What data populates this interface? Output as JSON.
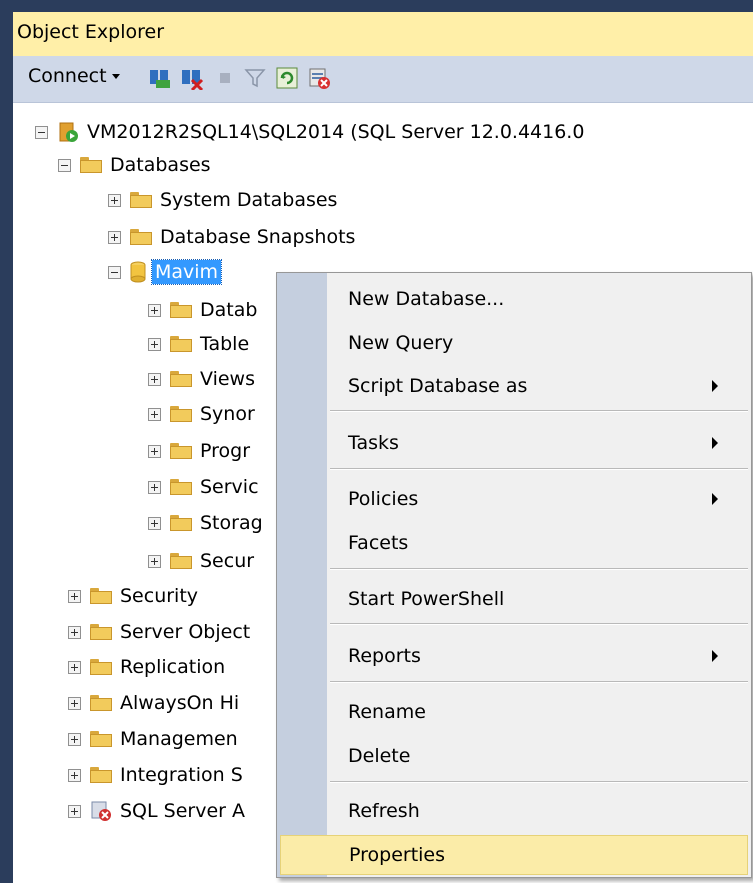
{
  "panel": {
    "title": "Object Explorer"
  },
  "toolbar": {
    "connect_label": "Connect",
    "icons": [
      "connect-object-icon",
      "disconnect-icon",
      "stop-icon",
      "filter-icon",
      "refresh-icon",
      "activity-monitor-icon"
    ]
  },
  "tree": {
    "server": "VM2012R2SQL14\\SQL2014 (SQL Server 12.0.4416.0",
    "databases": "Databases",
    "system_databases": "System Databases",
    "database_snapshots": "Database Snapshots",
    "selected_db": "Mavim",
    "db_children": [
      "Datab",
      "Table",
      "Views",
      "Synor",
      "Progr",
      "Servic",
      "Storag",
      "Secur"
    ],
    "server_children": [
      "Security",
      "Server Object",
      "Replication",
      "AlwaysOn Hi",
      "Managemen",
      "Integration S",
      "SQL Server A"
    ]
  },
  "context_menu": {
    "items": {
      "new_database": "New Database...",
      "new_query": "New Query",
      "script_database_as": "Script Database as",
      "tasks": "Tasks",
      "policies": "Policies",
      "facets": "Facets",
      "start_powershell": "Start PowerShell",
      "reports": "Reports",
      "rename": "Rename",
      "delete": "Delete",
      "refresh": "Refresh",
      "properties": "Properties"
    },
    "highlighted": "Properties"
  },
  "colors": {
    "window_border": "#2b3d5c",
    "title_bg": "#ffefa8",
    "toolbar_bg": "#cfd8e8",
    "selection": "#3399ff",
    "menu_highlight": "#fbeca8",
    "menu_gutter": "#c5cfdf"
  }
}
